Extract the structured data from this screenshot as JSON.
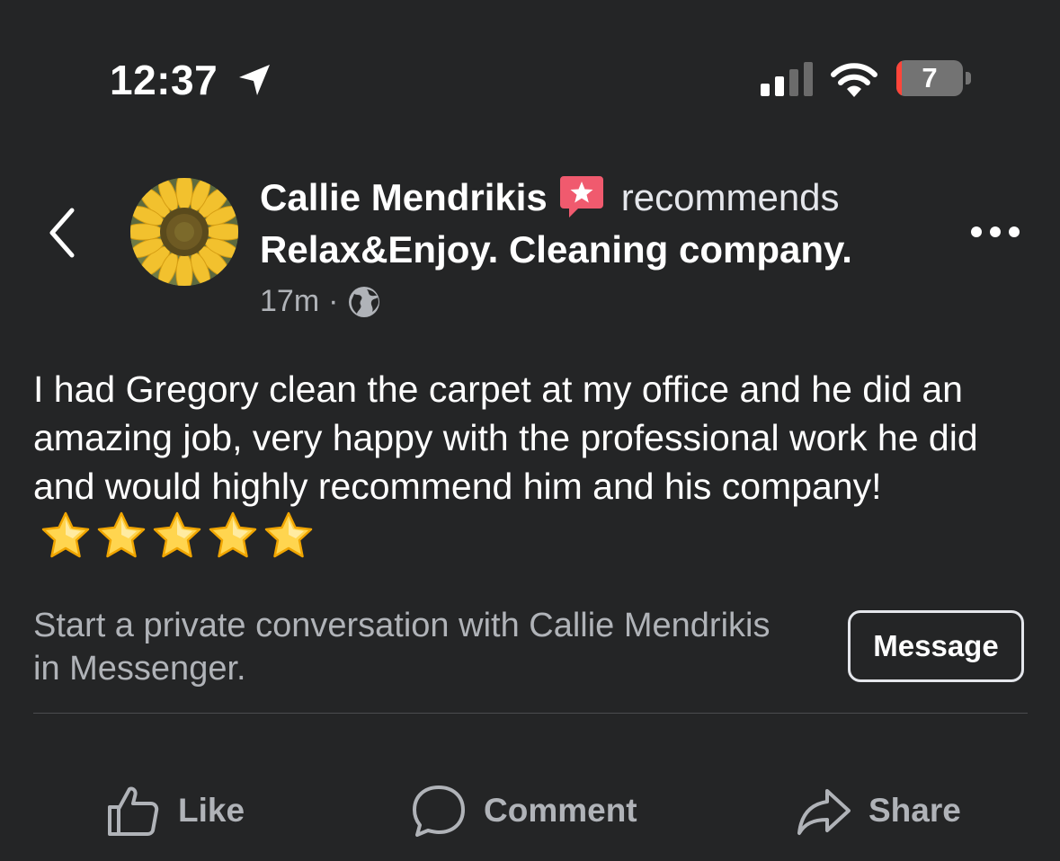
{
  "status_bar": {
    "time": "12:37",
    "battery_level": "7",
    "icons": [
      "location-arrow-icon",
      "cellular-signal-icon",
      "wifi-icon",
      "battery-icon"
    ]
  },
  "header": {
    "author": "Callie Mendrikis",
    "action": "recommends",
    "page": "Relax&Enjoy. Cleaning company.",
    "timestamp": "17m",
    "separator": "·",
    "audience_icon": "globe-icon",
    "badge_icon": "recommendation-star-icon",
    "back_icon": "chevron-left-icon",
    "more_icon": "more-dots-icon"
  },
  "post": {
    "text": "I had Gregory clean the carpet at my office and he did an amazing job, very happy with the professional work he did and would highly recommend him and his company!",
    "star_count": 5
  },
  "messenger_prompt": {
    "text": "Start a private conversation with Callie Mendrikis in Messenger.",
    "button_label": "Message"
  },
  "actions": {
    "like": "Like",
    "comment": "Comment",
    "share": "Share"
  },
  "colors": {
    "background": "#242526",
    "primary_text": "#e4e6eb",
    "secondary_text": "#b0b3b8",
    "badge": "#f05a6e",
    "battery_low": "#ff453a"
  }
}
